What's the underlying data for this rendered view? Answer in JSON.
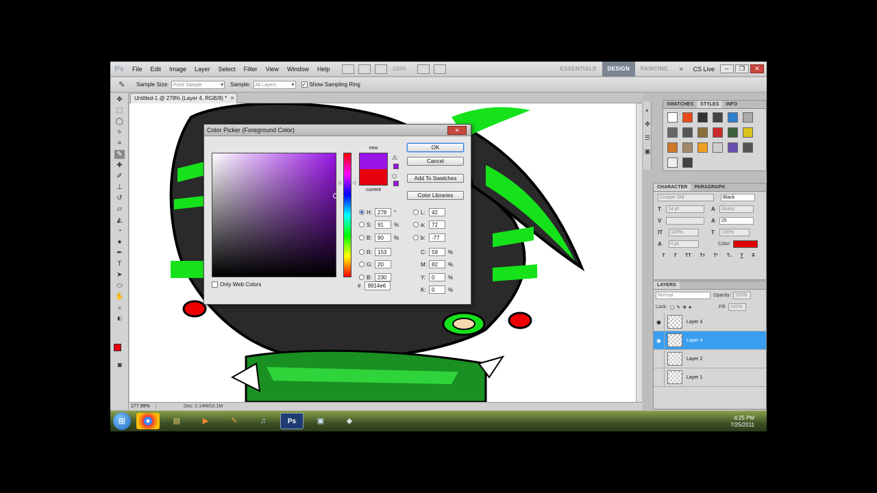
{
  "app": {
    "logo": "Ps",
    "menu": [
      "File",
      "Edit",
      "Image",
      "Layer",
      "Select",
      "Filter",
      "View",
      "Window",
      "Help"
    ],
    "zoom_combo": "100%",
    "workspaces": [
      "ESSENTIALS",
      "DESIGN",
      "PAINTING"
    ],
    "active_workspace": "DESIGN",
    "more": "»",
    "cs_live": "CS Live"
  },
  "options": {
    "sample_size_label": "Sample Size:",
    "sample_size_value": "Point Sample",
    "sample_label": "Sample:",
    "sample_value": "All Layers",
    "show_ring_label": "Show Sampling Ring"
  },
  "document": {
    "tab_title": "Untitled-1 @ 278% (Layer 4, RGB/8) *",
    "zoom_status": "277.99%",
    "doc_status": "Doc: 2.14M/10.1M"
  },
  "dialog": {
    "title": "Color Picker (Foreground Color)",
    "new_label": "new",
    "current_label": "current",
    "new_color": "#9914e6",
    "current_color": "#e6020d",
    "ok": "OK",
    "cancel": "Cancel",
    "add_swatches": "Add To Swatches",
    "color_libraries": "Color Libraries",
    "fields_left": [
      {
        "label": "H:",
        "value": "278",
        "unit": "°",
        "checked": true
      },
      {
        "label": "S:",
        "value": "91",
        "unit": "%",
        "checked": false
      },
      {
        "label": "B:",
        "value": "90",
        "unit": "%",
        "checked": false
      },
      {
        "label": "R:",
        "value": "153",
        "unit": "",
        "checked": false
      },
      {
        "label": "G:",
        "value": "20",
        "unit": "",
        "checked": false
      },
      {
        "label": "B:",
        "value": "230",
        "unit": "",
        "checked": false
      }
    ],
    "fields_right": [
      {
        "label": "L:",
        "value": "42",
        "unit": ""
      },
      {
        "label": "a:",
        "value": "72",
        "unit": ""
      },
      {
        "label": "b:",
        "value": "-77",
        "unit": ""
      },
      {
        "label": "C:",
        "value": "59",
        "unit": "%"
      },
      {
        "label": "M:",
        "value": "82",
        "unit": "%"
      },
      {
        "label": "Y:",
        "value": "0",
        "unit": "%"
      },
      {
        "label": "K:",
        "value": "0",
        "unit": "%"
      }
    ],
    "hex_label": "#",
    "hex_value": "9914e6",
    "only_web_colors": "Only Web Colors"
  },
  "panels": {
    "swatch_tabs": [
      "SWATCHES",
      "STYLES",
      "INFO"
    ],
    "active_swatch_tab": "STYLES",
    "style_colors": [
      "#ffffff",
      "#e84a1b",
      "#333333",
      "#444444",
      "#2f7fd0",
      "#aaaaaa",
      "#666666",
      "#555555",
      "#8a6d3b",
      "#cc2b2b",
      "#3a5f3a",
      "#d9c21a",
      "#d07a2a",
      "#a38a6b",
      "#f0a020",
      "#cfcfcf",
      "#6a4fb0",
      "#555555",
      "#eeeeee",
      "#444444"
    ],
    "char_tabs": [
      "CHARACTER",
      "PARAGRAPH"
    ],
    "font_family": "Cooper Std",
    "font_style": "Black",
    "font_size": "24 pt",
    "leading": "(Auto)",
    "tracking": "25",
    "vscale": "100%",
    "hscale": "100%",
    "baseline": "0 pt",
    "color_label": "Color:",
    "text_color": "#e00000",
    "layers_tab": "LAYERS",
    "blend_mode": "Normal",
    "opacity_label": "Opacity:",
    "opacity": "100%",
    "lock_label": "Lock:",
    "fill_label": "Fill:",
    "fill": "100%",
    "layers": [
      {
        "name": "Layer 3",
        "selected": false,
        "visible": true
      },
      {
        "name": "Layer 4",
        "selected": true,
        "visible": true
      },
      {
        "name": "Layer 2",
        "selected": false,
        "visible": false
      },
      {
        "name": "Layer 1",
        "selected": false,
        "visible": false
      }
    ]
  },
  "taskbar": {
    "time": "4:25 PM",
    "date": "7/25/2011"
  }
}
